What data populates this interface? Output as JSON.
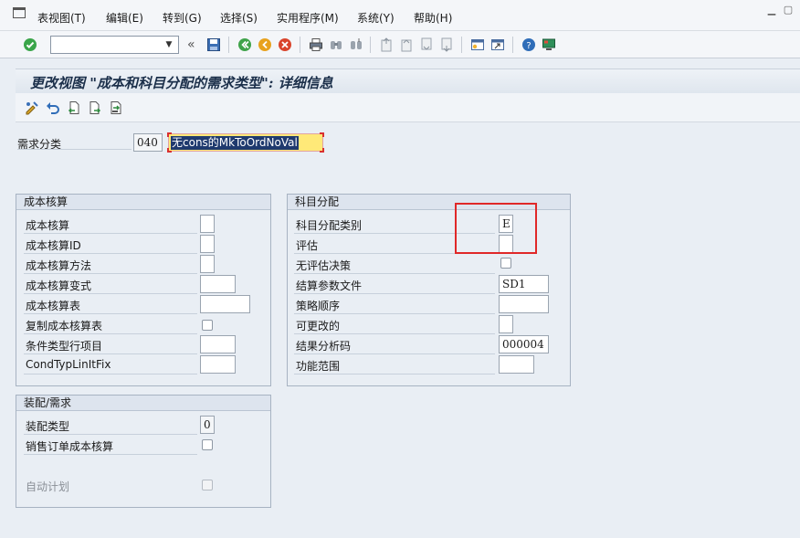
{
  "menubar": {
    "items": [
      "表视图(T)",
      "编辑(E)",
      "转到(G)",
      "选择(S)",
      "实用程序(M)",
      "系统(Y)",
      "帮助(H)"
    ]
  },
  "toolbar": {
    "command_value": "",
    "icons": [
      "enter-icon",
      "back-icon",
      "save-icon",
      "back-nav-icon",
      "exit-icon",
      "cancel-icon",
      "print-icon",
      "find-icon",
      "find-next-icon",
      "first-page-icon",
      "prev-page-icon",
      "next-page-icon",
      "last-page-icon",
      "create-session-icon",
      "shortcut-icon",
      "help-icon",
      "customize-layout-icon"
    ]
  },
  "title": "更改视图 \"成本和科目分配的需求类型\": 详细信息",
  "app_toolbar": {
    "icons": [
      "other-entry-icon",
      "undo-icon",
      "previous-entry-icon",
      "next-entry-icon",
      "select-entry-icon"
    ]
  },
  "header": {
    "label": "需求分类",
    "code": "040",
    "description": "无cons的MkToOrdNoVal"
  },
  "cost_group": {
    "title": "成本核算",
    "rows": [
      {
        "label": "成本核算",
        "type": "field",
        "value": ""
      },
      {
        "label": "成本核算ID",
        "type": "field",
        "value": ""
      },
      {
        "label": "成本核算方法",
        "type": "field",
        "value": ""
      },
      {
        "label": "成本核算变式",
        "type": "field",
        "value": ""
      },
      {
        "label": "成本核算表",
        "type": "field",
        "value": ""
      },
      {
        "label": "复制成本核算表",
        "type": "checkbox",
        "value": ""
      },
      {
        "label": "条件类型行项目",
        "type": "field",
        "value": ""
      },
      {
        "label": "CondTypLinItFix",
        "type": "field",
        "value": ""
      }
    ]
  },
  "account_group": {
    "title": "科目分配",
    "rows": [
      {
        "label": "科目分配类别",
        "type": "field",
        "value": "E"
      },
      {
        "label": "评估",
        "type": "field",
        "value": ""
      },
      {
        "label": "无评估决策",
        "type": "checkbox",
        "value": ""
      },
      {
        "label": "结算参数文件",
        "type": "field",
        "value": "SD1"
      },
      {
        "label": "策略顺序",
        "type": "field",
        "value": ""
      },
      {
        "label": "可更改的",
        "type": "field",
        "value": ""
      },
      {
        "label": "结果分析码",
        "type": "field",
        "value": "000004"
      },
      {
        "label": "功能范围",
        "type": "field",
        "value": ""
      }
    ]
  },
  "config_group": {
    "title": "装配/需求",
    "rows": [
      {
        "label": "装配类型",
        "type": "field",
        "value": "0"
      },
      {
        "label": "销售订单成本核算",
        "type": "checkbox",
        "value": ""
      },
      {
        "label": "自动计划",
        "type": "checkbox",
        "value": ""
      }
    ]
  },
  "colors": {
    "highlight_red": "#e02828",
    "selected_text_bg": "#1f3a6e",
    "input_yellow": "#ffe978"
  }
}
